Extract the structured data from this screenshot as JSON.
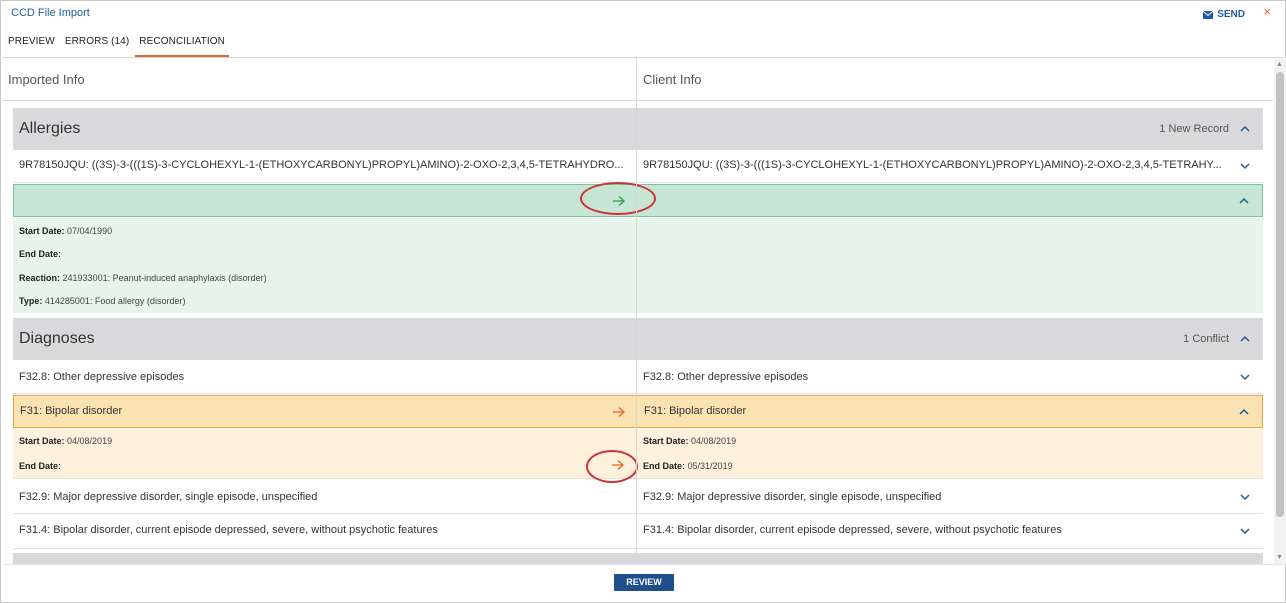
{
  "window": {
    "title": "CCD File Import",
    "send_label": "SEND",
    "close_glyph": "×"
  },
  "tabs": [
    {
      "label": "PREVIEW"
    },
    {
      "label": "ERRORS (14)"
    },
    {
      "label": "RECONCILIATION",
      "active": true
    }
  ],
  "columns": {
    "left": "Imported Info",
    "right": "Client Info"
  },
  "allergies": {
    "title": "Allergies",
    "status": "1 New Record",
    "record": {
      "left": "9R78150JQU: ((3S)-3-(((1S)-3-CYCLOHEXYL-1-(ETHOXYCARBONYL)PROPYL)AMINO)-2-OXO-2,3,4,5-TETRAHYDRO...",
      "right": "9R78150JQU: ((3S)-3-(((1S)-3-CYCLOHEXYL-1-(ETHOXYCARBONYL)PROPYL)AMINO)-2-OXO-2,3,4,5-TETRAHY..."
    },
    "details": {
      "start_label": "Start Date:",
      "start_value": "07/04/1990",
      "end_label": "End Date:",
      "end_value": "",
      "reaction_label": "Reaction:",
      "reaction_value": "241933001: Peanut-induced anaphylaxis (disorder)",
      "type_label": "Type:",
      "type_value": "414285001: Food allergy (disorder)"
    }
  },
  "diagnoses": {
    "title": "Diagnoses",
    "status": "1 Conflict",
    "rows": [
      {
        "left": "F32.8: Other depressive episodes",
        "right": "F32.8: Other depressive episodes"
      },
      {
        "left": "F31: Bipolar disorder",
        "right": "F31: Bipolar disorder"
      },
      {
        "left": "F32.9: Major depressive disorder, single episode, unspecified",
        "right": "F32.9: Major depressive disorder, single episode, unspecified"
      },
      {
        "left": "F31.4: Bipolar disorder, current episode depressed, severe, without psychotic features",
        "right": "F31.4: Bipolar disorder, current episode depressed, severe, without psychotic features"
      }
    ],
    "conflict": {
      "left_start_label": "Start Date:",
      "left_start_value": "04/08/2019",
      "left_end_label": "End Date:",
      "left_end_value": "",
      "right_start_label": "Start Date:",
      "right_start_value": "04/08/2019",
      "right_end_label": "End Date:",
      "right_end_value": "05/31/2019"
    }
  },
  "footer": {
    "review_label": "REVIEW"
  },
  "icons": {
    "send": "envelope-icon",
    "expand": "chevron-down-icon",
    "collapse": "chevron-up-icon",
    "accept": "arrow-right-icon"
  },
  "colors": {
    "accent_blue": "#1f5a9e",
    "accent_orange": "#e0662b",
    "new_record_green": "#c6e6d3",
    "conflict_orange": "#fbe2b3",
    "review_button": "#1e4e8c",
    "annotation_ring": "#c9343a"
  }
}
